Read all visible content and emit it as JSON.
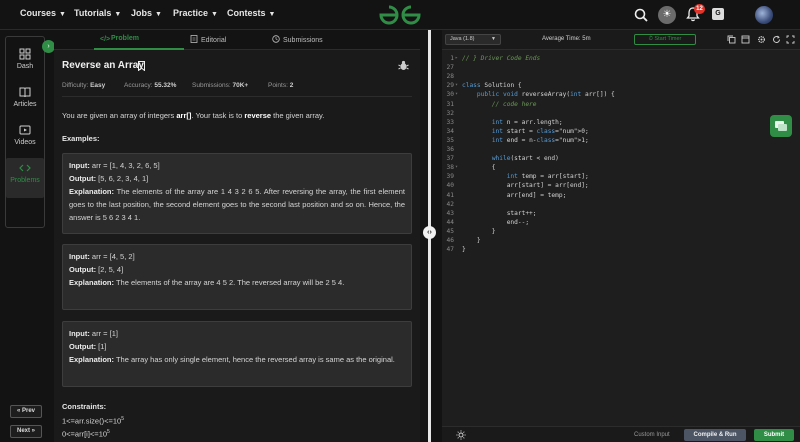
{
  "nav": {
    "items": [
      "Courses",
      "Tutorials",
      "Jobs",
      "Practice",
      "Contests"
    ],
    "notification_count": "12",
    "logo_color": "#2f8d46"
  },
  "rail": {
    "items": [
      {
        "label": "Dash",
        "icon": "dashboard-icon"
      },
      {
        "label": "Articles",
        "icon": "book-icon"
      },
      {
        "label": "Videos",
        "icon": "video-icon"
      },
      {
        "label": "Problems",
        "icon": "code-icon"
      }
    ],
    "prev": "« Prev",
    "next": "Next »"
  },
  "tabs": {
    "problem": "Problem",
    "editorial": "Editorial",
    "submissions": "Submissions"
  },
  "problem": {
    "title": "Reverse an Array",
    "difficulty_label": "Difficulty:",
    "difficulty": "Easy",
    "accuracy_label": "Accuracy:",
    "accuracy": "55.32%",
    "submissions_label": "Submissions:",
    "submissions": "70K+",
    "points_label": "Points:",
    "points": "2",
    "desc_1": "You are given an array of integers ",
    "desc_arr": "arr[]",
    "desc_2": ". Your task is to ",
    "desc_reverse": "reverse",
    "desc_3": " the given array.",
    "examples_heading": "Examples:",
    "input_label": "Input:",
    "output_label": "Output:",
    "explanation_label": "Explanation:",
    "examples": [
      {
        "input": "arr = [1, 4, 3, 2, 6, 5]",
        "output": "[5, 6, 2, 3, 4, 1]",
        "explanation": "The elements of the array are 1 4 3 2 6 5. After reversing the array, the first element goes to the last position, the second element goes to the second last position and so on. Hence, the answer is 5 6 2 3 4 1."
      },
      {
        "input": "arr = [4, 5, 2]",
        "output": "[2, 5, 4]",
        "explanation": "The elements of the array are 4 5 2. The reversed array will be 2 5 4."
      },
      {
        "input": "arr = [1]",
        "output": "[1]",
        "explanation": "The array has only single element, hence the reversed array is same as the original."
      }
    ],
    "constraints_heading": "Constraints:",
    "constraint_1": "1<=arr.size()<=10",
    "constraint_2": "0<=arr[i]<=10",
    "constraint_exp": "5"
  },
  "editor": {
    "language": "Java (1.8)",
    "avg_time": "Average Time: 5m",
    "timer": "Start Timer",
    "custom_input": "Custom Input",
    "compile": "Compile & Run",
    "submit": "Submit",
    "lines": [
      {
        "n": "1",
        "f": "▸",
        "t": "// } Driver Code Ends"
      },
      {
        "n": "27",
        "f": "",
        "t": ""
      },
      {
        "n": "28",
        "f": "",
        "t": ""
      },
      {
        "n": "29",
        "f": "▾",
        "t": "class Solution {"
      },
      {
        "n": "30",
        "f": "▾",
        "t": "    public void reverseArray(int arr[]) {"
      },
      {
        "n": "31",
        "f": "",
        "t": "        // code here"
      },
      {
        "n": "32",
        "f": "",
        "t": ""
      },
      {
        "n": "33",
        "f": "",
        "t": "        int n = arr.length;"
      },
      {
        "n": "34",
        "f": "",
        "t": "        int start = 0;"
      },
      {
        "n": "35",
        "f": "",
        "t": "        int end = n-1;"
      },
      {
        "n": "36",
        "f": "",
        "t": ""
      },
      {
        "n": "37",
        "f": "",
        "t": "        while(start < end)"
      },
      {
        "n": "38",
        "f": "▾",
        "t": "        {"
      },
      {
        "n": "39",
        "f": "",
        "t": "            int temp = arr[start];"
      },
      {
        "n": "40",
        "f": "",
        "t": "            arr[start] = arr[end];"
      },
      {
        "n": "41",
        "f": "",
        "t": "            arr[end] = temp;"
      },
      {
        "n": "42",
        "f": "",
        "t": ""
      },
      {
        "n": "43",
        "f": "",
        "t": "            start++;"
      },
      {
        "n": "44",
        "f": "",
        "t": "            end--;"
      },
      {
        "n": "45",
        "f": "",
        "t": "        }"
      },
      {
        "n": "46",
        "f": "",
        "t": "    }"
      },
      {
        "n": "47",
        "f": "",
        "t": "}"
      }
    ]
  }
}
